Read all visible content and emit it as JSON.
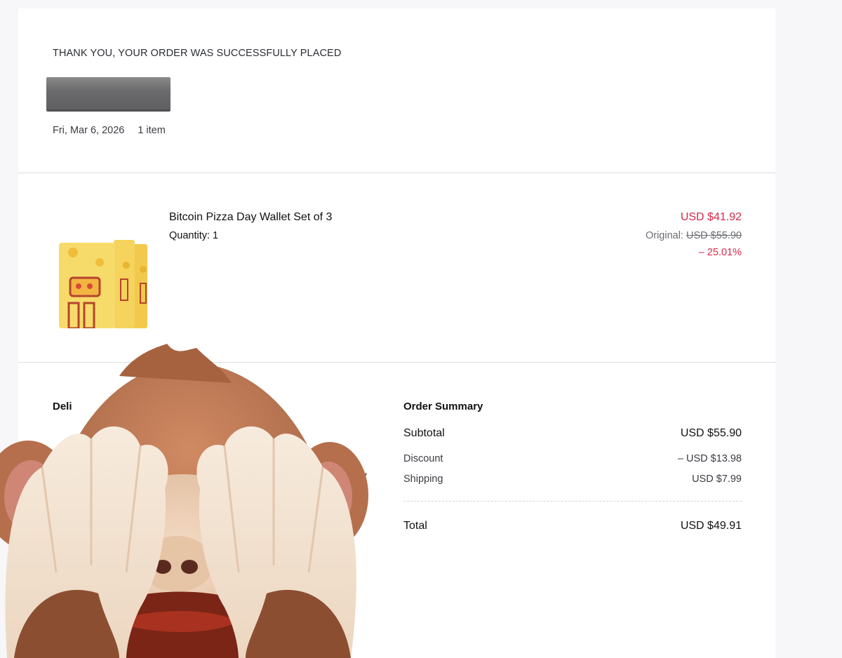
{
  "header": {
    "thank_you": "THANK YOU, YOUR ORDER WAS SUCCESSFULLY PLACED",
    "date": "Fri, Mar 6, 2026",
    "item_count": "1 item"
  },
  "product": {
    "name": "Bitcoin Pizza Day Wallet Set of 3",
    "quantity": "Quantity: 1",
    "price": "USD $41.92",
    "original_label": "Original:",
    "original_price": "USD $55.90",
    "discount_pct": "– 25.01%"
  },
  "delivery": {
    "title_fragment": "Deli",
    "text_fragment": "a,"
  },
  "summary": {
    "title": "Order Summary",
    "subtotal_label": "Subtotal",
    "subtotal_value": "USD $55.90",
    "discount_label": "Discount",
    "discount_value": "– USD $13.98",
    "shipping_label": "Shipping",
    "shipping_value": "USD $7.99",
    "total_label": "Total",
    "total_value": "USD $49.91"
  },
  "colors": {
    "accent_red": "#d6294a",
    "card_bg": "#ffffff",
    "page_bg": "#f7f7f9",
    "monkey_fur": "#b8714d"
  },
  "icons": {
    "overlay": "see-no-evil-monkey-emoji",
    "product_image": "pizza-wallet-cards"
  }
}
